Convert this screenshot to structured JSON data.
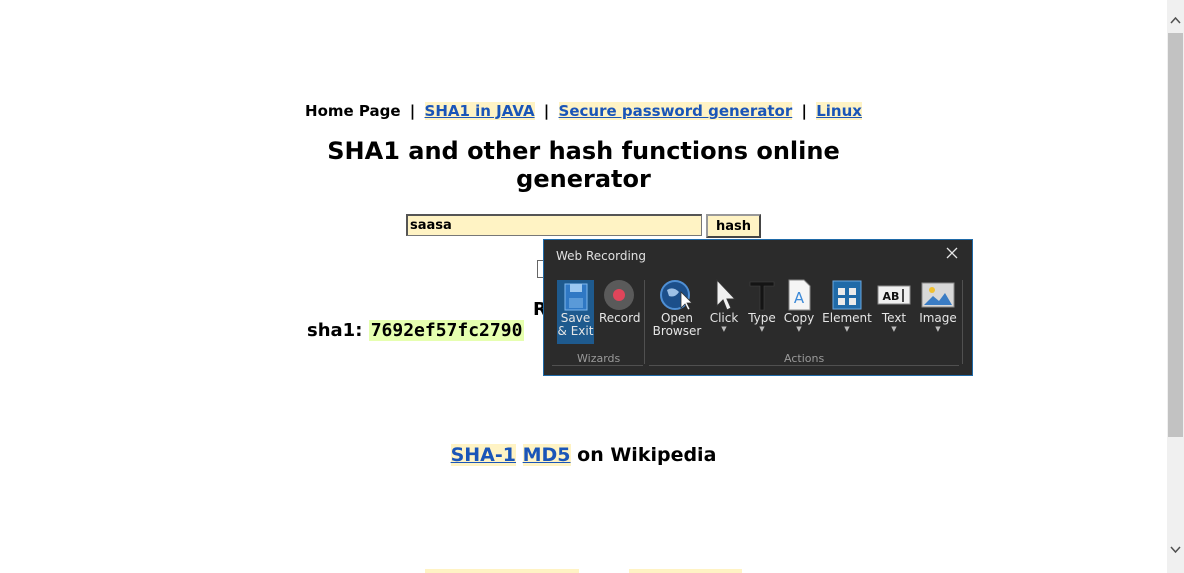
{
  "nav": {
    "home": "Home Page",
    "separator": "|",
    "links": [
      "SHA1 in JAVA",
      "Secure password generator",
      "Linux"
    ]
  },
  "title": "SHA1 and other hash functions online generator",
  "form": {
    "input_value": "saasa",
    "button_label": "hash"
  },
  "result": {
    "heading": "R",
    "label": "sha1:",
    "value": "7692ef57fc2790"
  },
  "wiki": {
    "links": [
      "SHA-1",
      "MD5"
    ],
    "suffix": "on Wikipedia"
  },
  "recorder": {
    "title": "Web Recording",
    "tools": {
      "save": [
        "Save",
        "& Exit"
      ],
      "record": "Record",
      "open_browser": [
        "Open",
        "Browser"
      ],
      "click": "Click",
      "type": "Type",
      "copy": "Copy",
      "element": "Element",
      "text": "Text",
      "image": "Image"
    },
    "groups": {
      "wizards": "Wizards",
      "actions": "Actions"
    },
    "colors": {
      "background": "#2b2b2b",
      "accent": "#1e5a8e",
      "record": "#e0455a"
    }
  },
  "colors": {
    "link": "#1a55b8",
    "link_highlight": "#fff3c4",
    "hash_highlight": "#e6ffb0"
  }
}
